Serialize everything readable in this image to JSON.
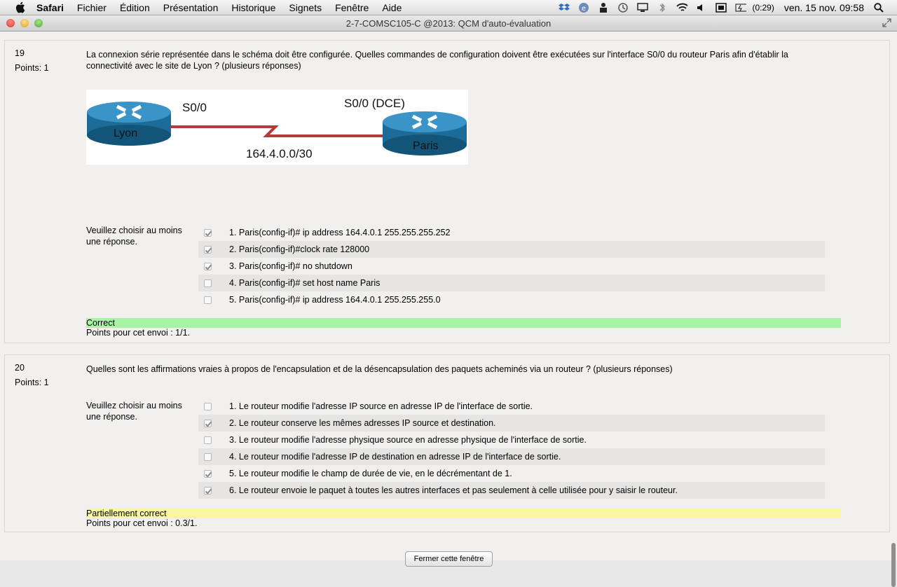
{
  "menubar": {
    "app": "Safari",
    "items": [
      "Fichier",
      "Édition",
      "Présentation",
      "Historique",
      "Signets",
      "Fenêtre",
      "Aide"
    ],
    "battery": "(0:29)",
    "datetime": "ven. 15 nov.  09:58"
  },
  "window": {
    "title": "2-7-COMSC105-C @2013: QCM d'auto-évaluation"
  },
  "q19": {
    "number": "19",
    "points": "Points: 1",
    "text": "La connexion série représentée dans le schéma doit être configurée. Quelles commandes de configuration doivent être exécutées sur l'interface S0/0 du routeur Paris afin d'établir la connectivité avec le site de Lyon ? (plusieurs réponses)",
    "diagram": {
      "lyon": "Lyon",
      "paris": "Paris",
      "s0": "S0/0",
      "s0dce": "S0/0 (DCE)",
      "network": "164.4.0.0/30"
    },
    "prompt": "Veuillez choisir au moins une réponse.",
    "options": [
      {
        "label": "1. Paris(config-if)# ip address 164.4.0.1 255.255.255.252",
        "checked": true
      },
      {
        "label": "2. Paris(config-if)#clock rate 128000",
        "checked": true
      },
      {
        "label": "3. Paris(config-if)# no shutdown",
        "checked": true
      },
      {
        "label": "4. Paris(config-if)# set host name Paris",
        "checked": false
      },
      {
        "label": "5. Paris(config-if)# ip address 164.4.0.1 255.255.255.0",
        "checked": false
      }
    ],
    "feedback": "Correct",
    "feedback_color": "#a5f5a5",
    "score": "Points pour cet envoi : 1/1."
  },
  "q20": {
    "number": "20",
    "points": "Points: 1",
    "text": "Quelles sont les affirmations vraies à propos de l'encapsulation et de la désencapsulation des paquets acheminés via un routeur ? (plusieurs réponses)",
    "prompt": "Veuillez choisir au moins une réponse.",
    "options": [
      {
        "label": "1. Le routeur modifie l'adresse IP source en adresse IP de l'interface de sortie.",
        "checked": false
      },
      {
        "label": "2. Le routeur conserve les mêmes adresses IP source et destination.",
        "checked": true
      },
      {
        "label": "3. Le routeur modifie l'adresse physique source en adresse physique de l'interface de sortie.",
        "checked": false
      },
      {
        "label": "4. Le routeur modifie l'adresse IP de destination en adresse IP de l'interface de sortie.",
        "checked": false
      },
      {
        "label": "5. Le routeur modifie le champ de durée de vie, en le décrémentant de 1.",
        "checked": true
      },
      {
        "label": "6. Le routeur envoie le paquet à toutes les autres interfaces et pas seulement à celle utilisée pour y saisir le routeur.",
        "checked": true
      }
    ],
    "feedback": "Partiellement correct",
    "feedback_color": "#fbf7a0",
    "score": "Points pour cet envoi : 0.3/1."
  },
  "close_button": "Fermer cette fenêtre"
}
